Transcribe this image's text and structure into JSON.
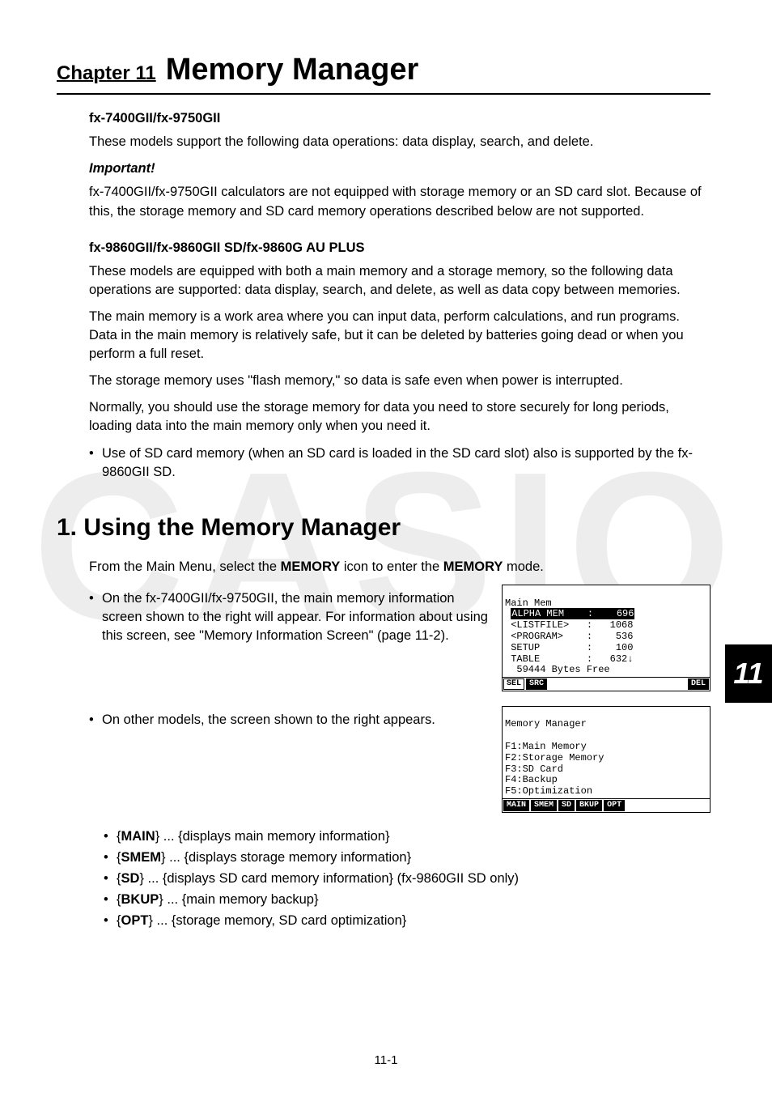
{
  "watermark": "CASIO",
  "chapter_tab": "11",
  "footer": "11-1",
  "chapter": {
    "label": "Chapter 11",
    "title": "Memory Manager"
  },
  "section1": {
    "model_a_title": "fx-7400GII/fx-9750GII",
    "model_a_p1": "These models support the following data operations: data display, search, and delete.",
    "important_label": "Important!",
    "important_p": "fx-7400GII/fx-9750GII calculators are not equipped with storage memory or an SD card slot. Because of this, the storage memory and SD card memory operations described below are not supported.",
    "model_b_title": "fx-9860GII/fx-9860GII SD/fx-9860G AU PLUS",
    "model_b_p1": "These models are equipped with both a main memory and a storage memory, so the following data operations are supported: data display, search, and delete, as well as data copy between memories.",
    "model_b_p2": "The main memory is a work area where you can input data, perform calculations, and run programs. Data in the main memory is relatively safe, but it can be deleted by batteries going dead or when you perform a full reset.",
    "model_b_p3": "The storage memory uses \"flash memory,\" so data is safe even when power is interrupted.",
    "model_b_p4": "Normally, you should use the storage memory for data you need to store securely for long periods, loading data into the main memory only when you need it.",
    "model_b_bullet": "Use of SD card memory (when an SD card is loaded in the SD card slot) also is supported by the fx-9860GII SD."
  },
  "section2": {
    "heading": "1. Using the Memory Manager",
    "intro_pre": "From the Main Menu, select the ",
    "intro_mem1": "MEMORY",
    "intro_mid": " icon to enter the ",
    "intro_mem2": "MEMORY",
    "intro_post": " mode.",
    "bullet1": "On the fx-7400GII/fx-9750GII, the main memory information screen shown to the right will appear. For information about using this screen, see \"Memory Information Screen\" (page 11-2).",
    "bullet2": "On other models, the screen shown to the right appears."
  },
  "screen1": {
    "l1": "Main Mem",
    "sel_label": "ALPHA MEM",
    "sel_val": "696",
    "r2a": " <LISTFILE>",
    "r2b": "1068",
    "r3a": " <PROGRAM>",
    "r3b": "536",
    "r4a": " SETUP",
    "r4b": "100",
    "r5a": " TABLE",
    "r5b": "632↓",
    "free": "  59444 Bytes Free",
    "b1": "SEL",
    "b2": "SRC",
    "b3": "DEL"
  },
  "screen2": {
    "l1": "Memory Manager",
    "l2": "F1:Main Memory",
    "l3": "F2:Storage Memory",
    "l4": "F3:SD Card",
    "l5": "F4:Backup",
    "l6": "F5:Optimization",
    "b1": "MAIN",
    "b2": "SMEM",
    "b3": "SD",
    "b4": "BKUP",
    "b5": "OPT"
  },
  "menu": {
    "items": [
      {
        "key": "MAIN",
        "desc": " ... {displays main memory information}"
      },
      {
        "key": "SMEM",
        "desc": " ... {displays storage memory information}"
      },
      {
        "key": "SD",
        "desc": " ... {displays SD card memory information} (fx-9860GII SD only)"
      },
      {
        "key": "BKUP",
        "desc": " ... {main memory backup}"
      },
      {
        "key": "OPT",
        "desc": " ... {storage memory, SD card optimization}"
      }
    ]
  }
}
